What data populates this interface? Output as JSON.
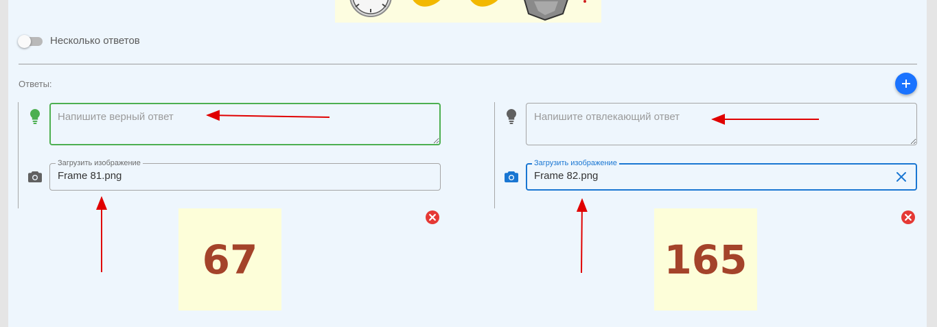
{
  "options": {
    "multiple_answers_label": "Несколько ответов",
    "multiple_answers_on": false
  },
  "answers": {
    "label": "Ответы:",
    "correct": {
      "placeholder": "Напишите верный ответ",
      "upload": {
        "label": "Загрузить изображение",
        "value": "Frame 81.png"
      },
      "image_text": "67"
    },
    "distractor": {
      "placeholder": "Напишите отвлекающий ответ",
      "upload": {
        "label": "Загрузить изображение",
        "value": "Frame 82.png"
      },
      "image_text": "165"
    }
  },
  "colors": {
    "correct_accent": "#4caf50",
    "focus_accent": "#1976d2",
    "add_button": "#1a73ff",
    "remove_button": "#e53935",
    "annotation_arrow": "#e00000"
  },
  "icons": [
    "lightbulb-icon",
    "camera-icon",
    "plus-icon",
    "close-icon",
    "remove-circle-icon"
  ]
}
